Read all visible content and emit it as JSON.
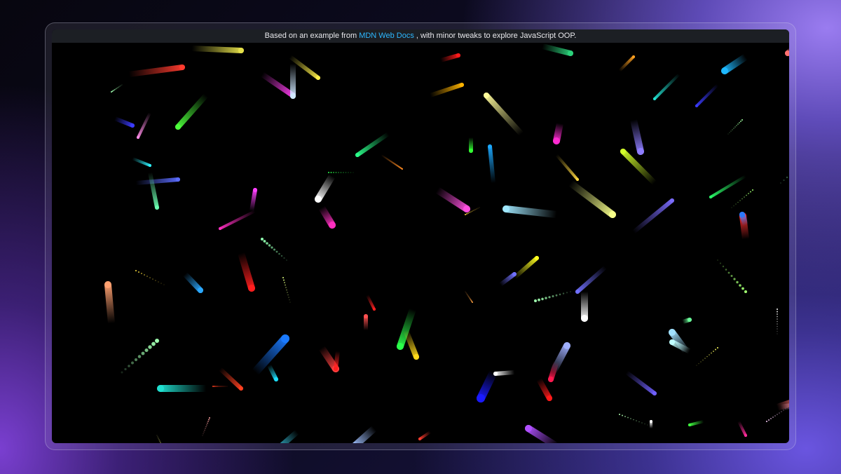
{
  "banner": {
    "prefix": "Based on an example from ",
    "link_text": "MDN Web Docs",
    "suffix": " , with minor tweaks to explore JavaScript OOP."
  },
  "colors": {
    "link": "#2db8ff",
    "canvas_background": "#000000",
    "banner_background": "#1c1f24"
  }
}
